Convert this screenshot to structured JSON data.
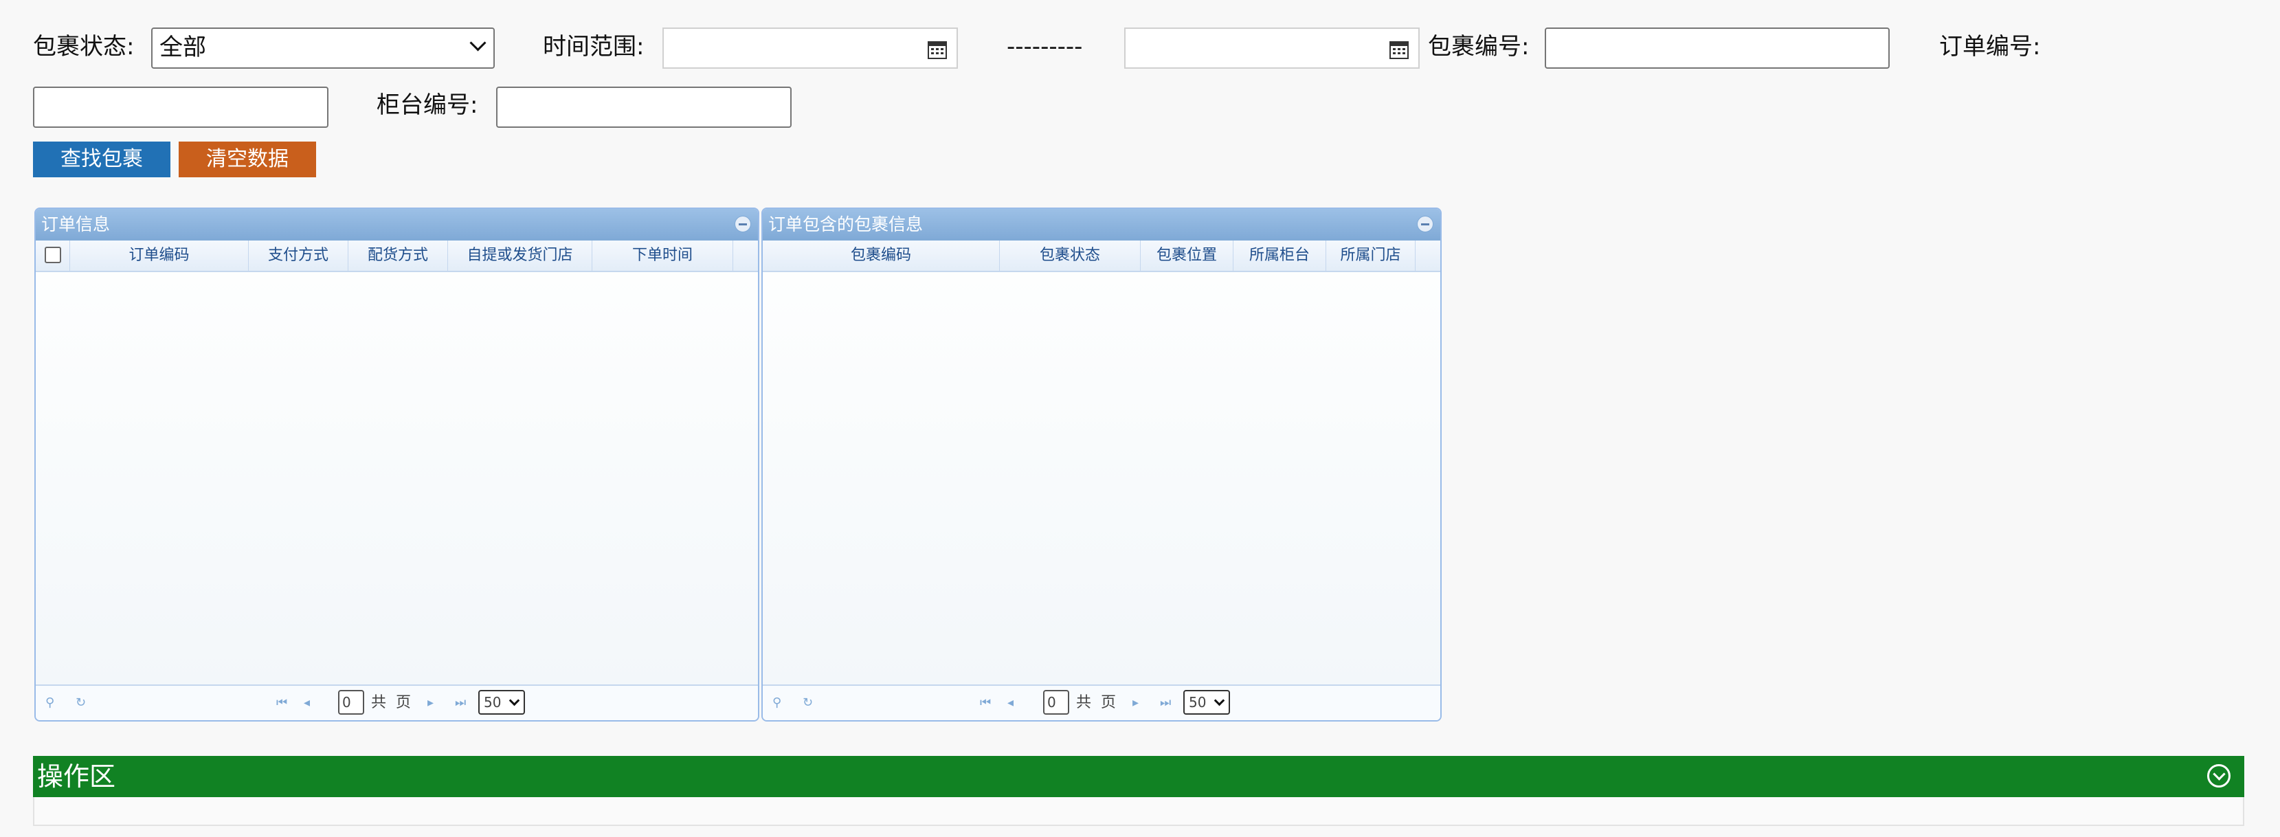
{
  "filters": {
    "status_label": "包裹状态:",
    "status_value": "全部",
    "time_label": "时间范围:",
    "time_separator": "---------",
    "package_no_label": "包裹编号:",
    "order_no_label": "订单编号:",
    "counter_no_label": "柜台编号:"
  },
  "buttons": {
    "search": "查找包裹",
    "clear": "清空数据"
  },
  "orders_grid": {
    "title": "订单信息",
    "columns": [
      "订单编码",
      "支付方式",
      "配货方式",
      "自提或发货门店",
      "下单时间"
    ],
    "pager": {
      "page": "0",
      "total_label": "共",
      "page_unit": "页",
      "page_size": "50"
    }
  },
  "packages_grid": {
    "title": "订单包含的包裹信息",
    "columns": [
      "包裹编码",
      "包裹状态",
      "包裹位置",
      "所属柜台",
      "所属门店"
    ],
    "pager": {
      "page": "0",
      "total_label": "共",
      "page_unit": "页",
      "page_size": "50"
    }
  },
  "operations": {
    "title": "操作区"
  },
  "colors": {
    "search_button": "#2171b5",
    "clear_button": "#c95f1c",
    "operations_bar": "#118223",
    "grid_header": "#8fb5df"
  }
}
